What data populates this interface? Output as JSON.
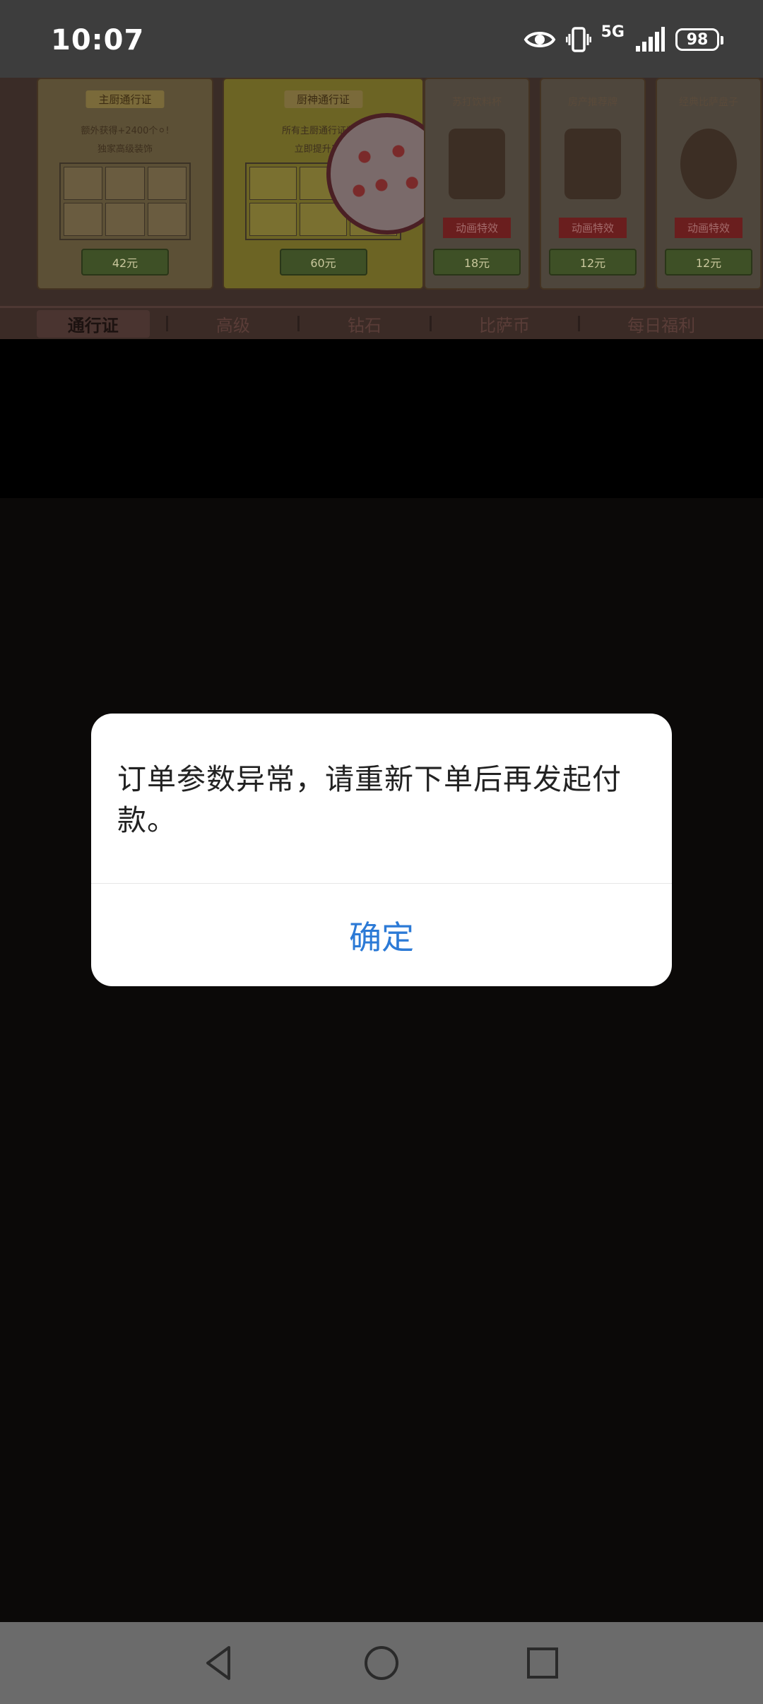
{
  "status_bar": {
    "time": "10:07",
    "network": "5G",
    "battery": "98",
    "icons": [
      "eye-icon",
      "vibrate-icon",
      "signal-icon",
      "battery-icon"
    ]
  },
  "background": {
    "cards": [
      {
        "ribbon": "主厨通行证",
        "line1": "额外获得+2400个⚪!",
        "line2": "独家高级装饰",
        "price": "42元"
      },
      {
        "ribbon": "厨神通行证",
        "line1": "所有主厨通行证奖励",
        "line2": "立即提升10级",
        "price": "60元"
      },
      {
        "ribbon": "苏打饮料杯",
        "tag": "动画特效",
        "price": "18元"
      },
      {
        "ribbon": "房产推荐牌",
        "tag": "动画特效",
        "price": "12元"
      },
      {
        "ribbon": "经典比萨盘子",
        "tag": "动画特效",
        "price": "12元"
      }
    ],
    "tabs": [
      "通行证",
      "高级",
      "钻石",
      "比萨币",
      "每日福利"
    ],
    "active_tab": "通行证"
  },
  "dialog": {
    "message": "订单参数异常，请重新下单后再发起付款。",
    "confirm_label": "确定"
  },
  "colors": {
    "accent": "#2c7ad6",
    "status_bar": "#3d3d3d",
    "nav_bar": "#6b6b6b"
  }
}
